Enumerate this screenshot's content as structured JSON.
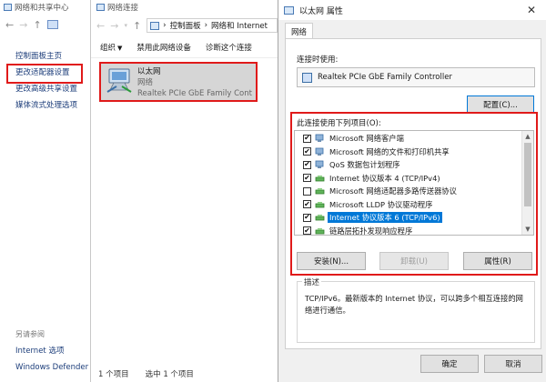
{
  "window1": {
    "title": "网络和共享中心",
    "links": [
      "控制面板主页",
      "更改适配器设置",
      "更改高级共享设置",
      "媒体流式处理选项"
    ],
    "see_also": "另请参阅",
    "bottom_links": [
      "Internet 选项",
      "Windows Defender 防火墙"
    ]
  },
  "window2": {
    "title": "网络连接",
    "address": [
      "控制面板",
      "网络和 Internet"
    ],
    "toolbar": [
      "组织",
      "禁用此网络设备",
      "诊断这个连接"
    ],
    "adapter": {
      "name": "以太网",
      "status": "网络",
      "device": "Realtek PCIe GbE Family Controller"
    },
    "status_count": "1 个项目",
    "status_selected": "选中 1 个项目"
  },
  "dialog": {
    "title": "以太网 属性",
    "close_glyph": "✕",
    "tab": "网络",
    "connect_using_label": "连接时使用:",
    "device": "Realtek PCIe GbE Family Controller",
    "configure_button": "配置(C)...",
    "items_label": "此连接使用下列项目(O):",
    "items": [
      {
        "label": "Microsoft 网络客户端",
        "checked": true,
        "icon": "network-client-icon",
        "selected": false
      },
      {
        "label": "Microsoft 网络的文件和打印机共享",
        "checked": true,
        "icon": "network-client-icon",
        "selected": false
      },
      {
        "label": "QoS 数据包计划程序",
        "checked": true,
        "icon": "network-client-icon",
        "selected": false
      },
      {
        "label": "Internet 协议版本 4 (TCP/IPv4)",
        "checked": true,
        "icon": "protocol-icon",
        "selected": false
      },
      {
        "label": "Microsoft 网络适配器多路传送器协议",
        "checked": false,
        "icon": "protocol-icon",
        "selected": false
      },
      {
        "label": "Microsoft LLDP 协议驱动程序",
        "checked": true,
        "icon": "protocol-icon",
        "selected": false
      },
      {
        "label": "Internet 协议版本 6 (TCP/IPv6)",
        "checked": true,
        "icon": "protocol-icon",
        "selected": true
      },
      {
        "label": "链路层拓扑发现响应程序",
        "checked": true,
        "icon": "protocol-icon",
        "selected": false
      }
    ],
    "install_button": "安装(N)...",
    "uninstall_button": "卸载(U)",
    "properties_button": "属性(R)",
    "description_title": "描述",
    "description_text": "TCP/IPv6。最新版本的 Internet 协议，可以跨多个相互连接的网络进行通信。",
    "ok_button": "确定",
    "cancel_button": "取消",
    "colors": {
      "highlight": "#0078d7",
      "annotation": "#e01a1a",
      "link": "#1c3d7a"
    }
  }
}
